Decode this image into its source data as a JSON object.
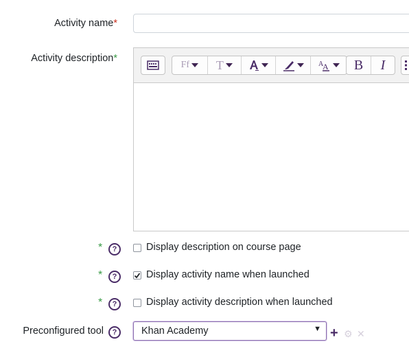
{
  "activity_name": {
    "label": "Activity name",
    "required_mark": "*",
    "value": ""
  },
  "activity_description": {
    "label": "Activity description",
    "required_mark": "*",
    "toolbar": {
      "font_family_label": "Ff",
      "font_size_label": "T",
      "bold_label": "B",
      "italic_label": "I"
    }
  },
  "options": [
    {
      "star": "*",
      "help": "?",
      "label": "Display description on course page",
      "checked": false
    },
    {
      "star": "*",
      "help": "?",
      "label": "Display activity name when launched",
      "checked": true
    },
    {
      "star": "*",
      "help": "?",
      "label": "Display activity description when launched",
      "checked": false
    }
  ],
  "preconfigured_tool": {
    "label": "Preconfigured tool",
    "help": "?",
    "selected": "Khan Academy",
    "arrow": "▼",
    "add_icon": "+",
    "settings_icon": "⚙",
    "remove_icon": "✕"
  },
  "colors": {
    "accent": "#4a2c67",
    "required_red": "#ca3120",
    "required_green": "#3a9b47"
  }
}
